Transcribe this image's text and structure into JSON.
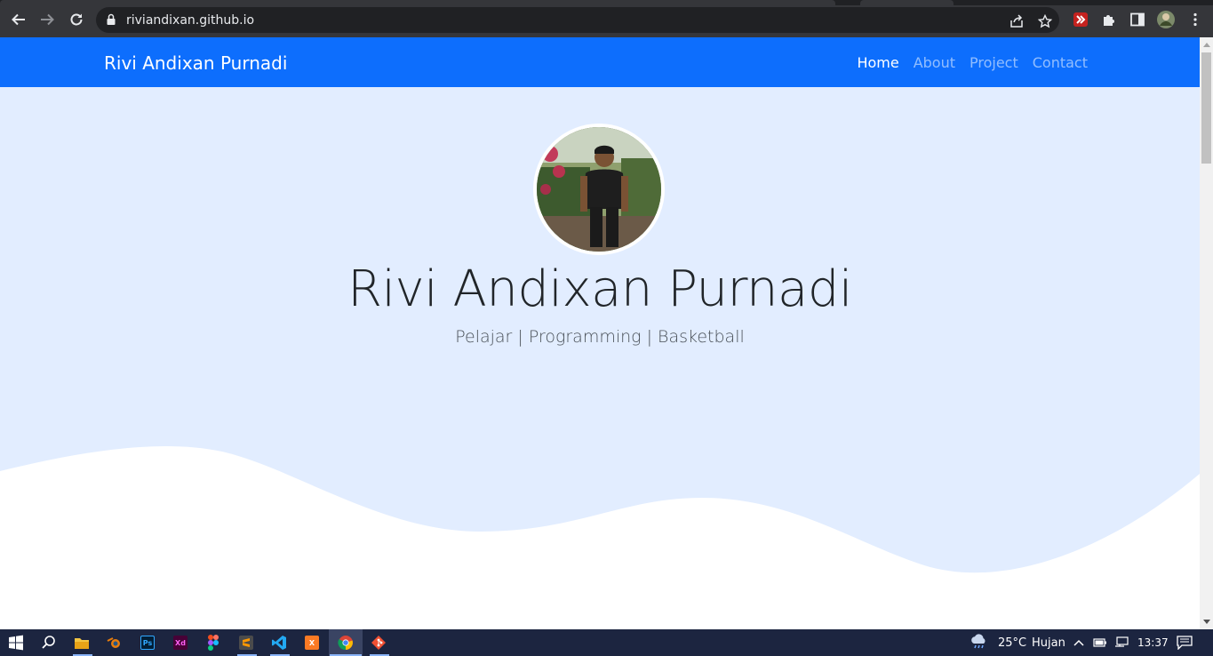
{
  "browser": {
    "url": "riviandixan.github.io",
    "icons": [
      "back-icon",
      "forward-icon",
      "reload-icon",
      "lock-icon",
      "share-icon",
      "bookmark-star-icon",
      "extension-icon",
      "puzzle-icon",
      "side-panel-icon",
      "profile-avatar",
      "menu-kebab-icon"
    ]
  },
  "site": {
    "brand": "Rivi Andixan Purnadi",
    "nav": [
      {
        "label": "Home",
        "active": true
      },
      {
        "label": "About",
        "active": false
      },
      {
        "label": "Project",
        "active": false
      },
      {
        "label": "Contact",
        "active": false
      }
    ],
    "hero": {
      "name": "Rivi Andixan Purnadi",
      "tagline": "Pelajar | Programming | Basketball"
    },
    "colors": {
      "navbar": "#0d6efd",
      "hero_bg": "#e2edff"
    }
  },
  "taskbar": {
    "apps": [
      "windows-start-icon",
      "search-icon",
      "file-explorer-icon",
      "blender-icon",
      "photoshop-icon",
      "adobe-xd-icon",
      "figma-icon",
      "sublime-text-icon",
      "vscode-icon",
      "xampp-icon",
      "chrome-icon",
      "git-icon"
    ],
    "weather_temp": "25°C",
    "weather_text": "Hujan",
    "time": "13:37"
  }
}
